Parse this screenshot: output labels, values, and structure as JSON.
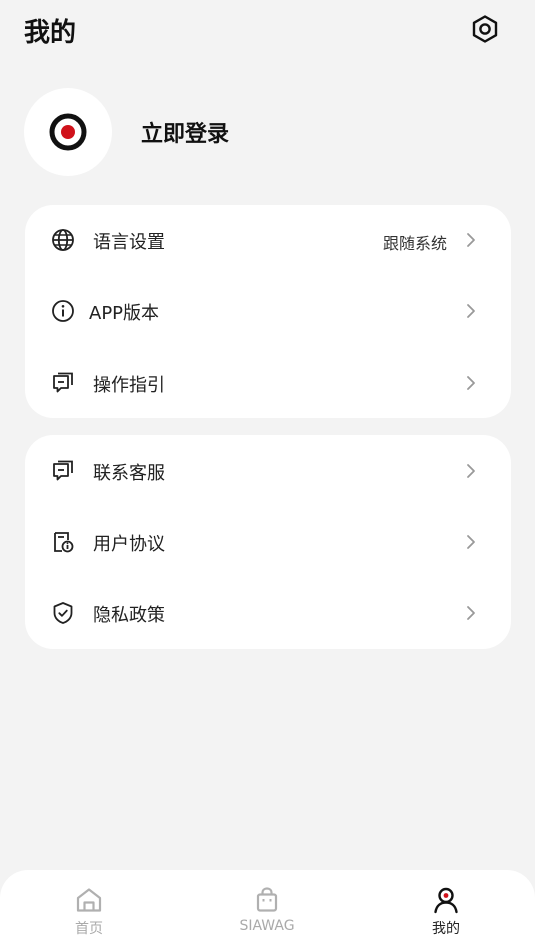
{
  "header": {
    "title": "我的",
    "settings_icon": "settings-hexagon-icon"
  },
  "profile": {
    "avatar_icon": "record-logo-icon",
    "login_label": "立即登录"
  },
  "section1": {
    "items": [
      {
        "icon": "globe-icon",
        "label": "语言设置",
        "value": "跟随系统"
      },
      {
        "icon": "info-circle-icon",
        "label": "APP版本"
      },
      {
        "icon": "guide-chat-icon",
        "label": "操作指引"
      }
    ]
  },
  "section2": {
    "items": [
      {
        "icon": "support-chat-icon",
        "label": "联系客服"
      },
      {
        "icon": "agreement-doc-icon",
        "label": "用户协议"
      },
      {
        "icon": "shield-check-icon",
        "label": "隐私政策"
      }
    ]
  },
  "tabbar": {
    "tabs": [
      {
        "icon": "home-icon",
        "label": "首页",
        "active": false
      },
      {
        "icon": "shopping-bag-icon",
        "label": "SIAWAG",
        "active": false
      },
      {
        "icon": "user-icon",
        "label": "我的",
        "active": true
      }
    ]
  },
  "colors": {
    "background": "#f3f3f3",
    "card": "#ffffff",
    "accent_red": "#d0121b",
    "text_primary": "#111111",
    "tab_inactive": "#aaaaaa"
  }
}
